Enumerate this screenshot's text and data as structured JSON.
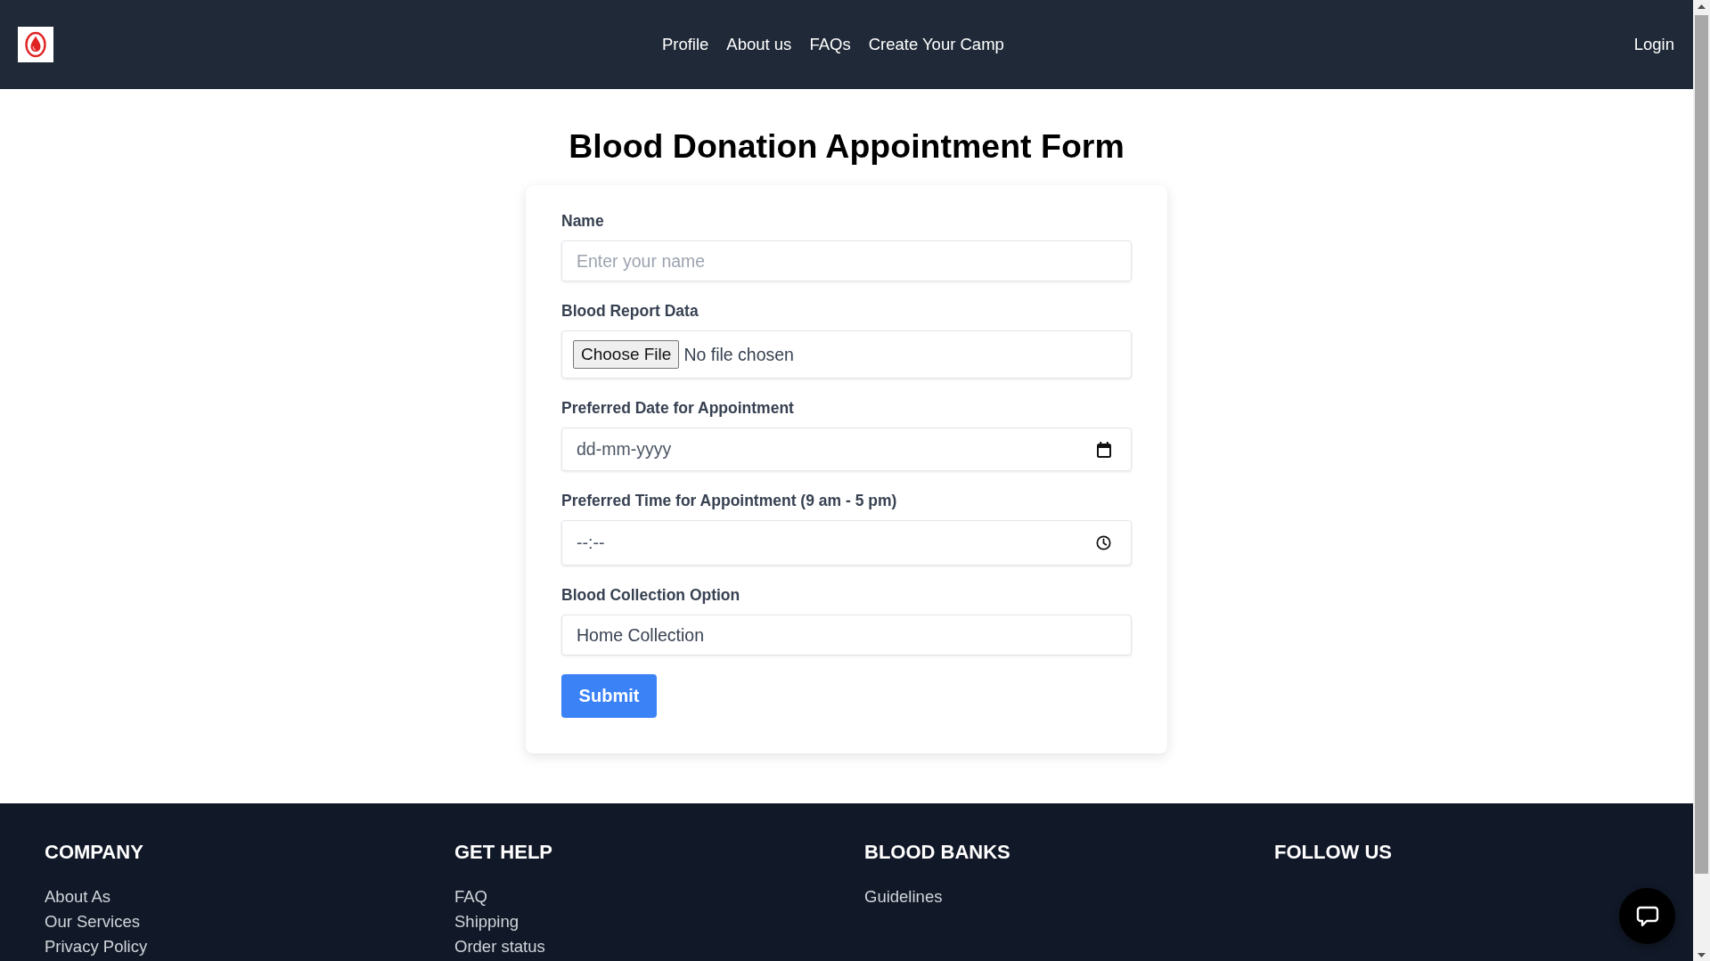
{
  "header": {
    "nav": [
      "Profile",
      "About us",
      "FAQs",
      "Create Your Camp"
    ],
    "login": "Login"
  },
  "form": {
    "title": "Blood Donation Appointment Form",
    "fields": [
      {
        "kind": "text",
        "label": "Name",
        "placeholder": "Enter your name"
      },
      {
        "kind": "file",
        "label": "Blood Report Data",
        "button": "Choose File",
        "status": "No file chosen"
      },
      {
        "kind": "date",
        "label": "Preferred Date for Appointment",
        "placeholder": "dd-mm-yyyy"
      },
      {
        "kind": "time",
        "label": "Preferred Time for Appointment (9 am - 5 pm)",
        "placeholder": "--:--"
      },
      {
        "kind": "text",
        "label": "Blood Collection Option",
        "value": "Home Collection"
      }
    ],
    "submit": "Submit"
  },
  "footer": {
    "columns": [
      {
        "heading": "COMPANY",
        "links": [
          "About As",
          "Our Services",
          "Privacy Policy"
        ]
      },
      {
        "heading": "GET HELP",
        "links": [
          "FAQ",
          "Shipping",
          "Order status"
        ]
      },
      {
        "heading": "BLOOD BANKS",
        "links": [
          "Guidelines"
        ]
      },
      {
        "heading": "FOLLOW US"
      }
    ]
  }
}
